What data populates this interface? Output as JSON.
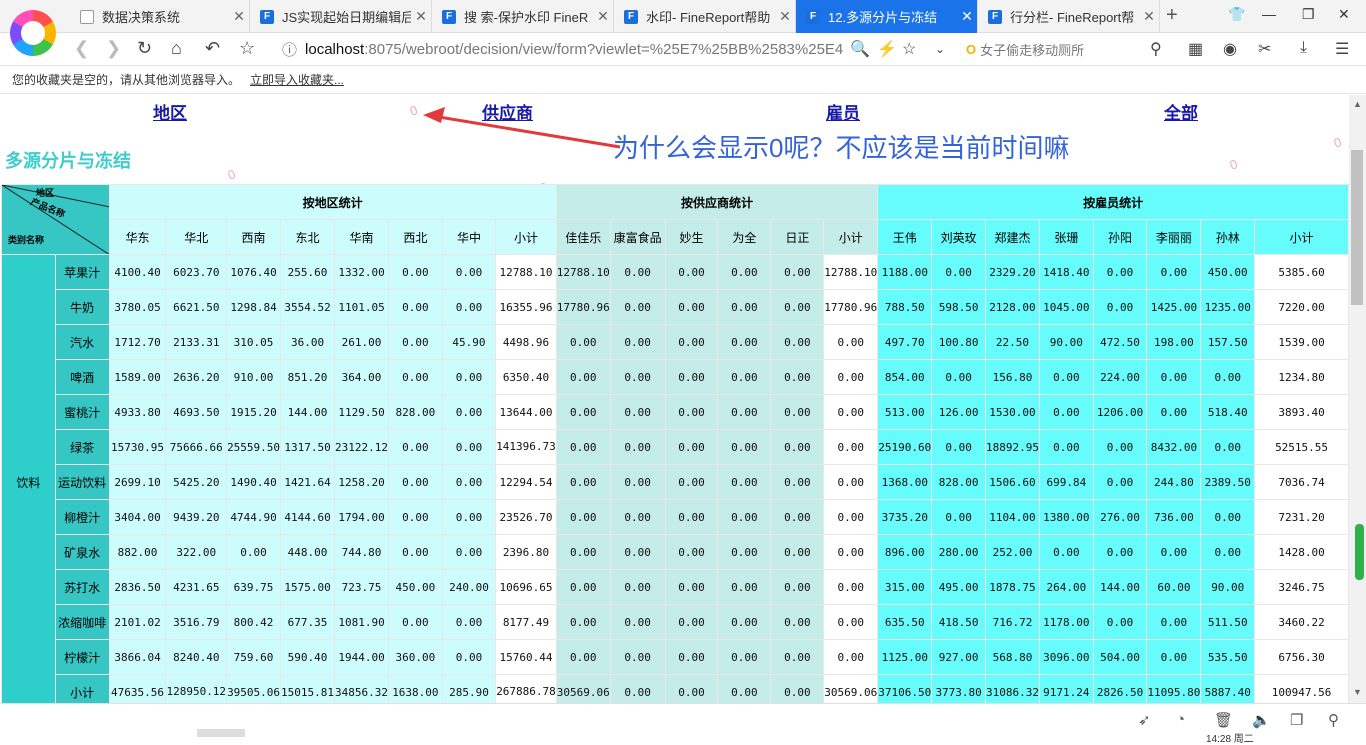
{
  "browser": {
    "tabs": [
      {
        "title": "数据决策系统",
        "icon": "doc",
        "active": false
      },
      {
        "title": "JS实现起始日期编辑后",
        "icon": "fr",
        "active": false
      },
      {
        "title": "搜 索-保护水印 FineR",
        "icon": "fr",
        "active": false
      },
      {
        "title": "水印- FineReport帮助",
        "icon": "fr",
        "active": false
      },
      {
        "title": "12.多源分片与冻结",
        "icon": "fr",
        "active": true
      },
      {
        "title": "行分栏- FineReport帮",
        "icon": "fr",
        "active": false
      }
    ],
    "url_host": "localhost",
    "url_path": ":8075/webroot/decision/view/form?viewlet=%25E7%25BB%2583%25E4",
    "search_placeholder": "女子偷走移动厕所",
    "favbar_text": "您的收藏夹是空的，请从其他浏览器导入。",
    "favbar_link": "立即导入收藏夹..."
  },
  "report": {
    "nav": [
      "地区",
      "供应商",
      "雇员",
      "全部"
    ],
    "title": "多源分片与冻结",
    "annotation": "为什么会显示0呢？不应该是当前时间嘛",
    "watermark_char": "0",
    "corner": {
      "region": "地区",
      "product": "产品名称",
      "category": "类别名称"
    },
    "groups": [
      {
        "label": "按地区统计"
      },
      {
        "label": "按供应商统计"
      },
      {
        "label": "按雇员统计"
      }
    ],
    "region_cols": [
      "华东",
      "华北",
      "西南",
      "东北",
      "华南",
      "西北",
      "华中",
      "小计"
    ],
    "supplier_cols": [
      "佳佳乐",
      "康富食品",
      "妙生",
      "为全",
      "日正",
      "小计"
    ],
    "employee_cols": [
      "王伟",
      "刘英玫",
      "郑建杰",
      "张珊",
      "孙阳",
      "李丽丽",
      "孙林",
      "小计"
    ],
    "category": "饮料",
    "rows": [
      {
        "name": "苹果汁",
        "region": [
          "4100.40",
          "6023.70",
          "1076.40",
          "255.60",
          "1332.00",
          "0.00",
          "0.00",
          "12788.10"
        ],
        "supplier": [
          "12788.10",
          "0.00",
          "0.00",
          "0.00",
          "0.00",
          "12788.10"
        ],
        "employee": [
          "1188.00",
          "0.00",
          "2329.20",
          "1418.40",
          "0.00",
          "0.00",
          "450.00",
          "5385.60"
        ]
      },
      {
        "name": "牛奶",
        "region": [
          "3780.05",
          "6621.50",
          "1298.84",
          "3554.52",
          "1101.05",
          "0.00",
          "0.00",
          "16355.96"
        ],
        "supplier": [
          "17780.96",
          "0.00",
          "0.00",
          "0.00",
          "0.00",
          "17780.96"
        ],
        "employee": [
          "788.50",
          "598.50",
          "2128.00",
          "1045.00",
          "0.00",
          "1425.00",
          "1235.00",
          "7220.00"
        ]
      },
      {
        "name": "汽水",
        "region": [
          "1712.70",
          "2133.31",
          "310.05",
          "36.00",
          "261.00",
          "0.00",
          "45.90",
          "4498.96"
        ],
        "supplier": [
          "0.00",
          "0.00",
          "0.00",
          "0.00",
          "0.00",
          "0.00"
        ],
        "employee": [
          "497.70",
          "100.80",
          "22.50",
          "90.00",
          "472.50",
          "198.00",
          "157.50",
          "1539.00"
        ]
      },
      {
        "name": "啤酒",
        "region": [
          "1589.00",
          "2636.20",
          "910.00",
          "851.20",
          "364.00",
          "0.00",
          "0.00",
          "6350.40"
        ],
        "supplier": [
          "0.00",
          "0.00",
          "0.00",
          "0.00",
          "0.00",
          "0.00"
        ],
        "employee": [
          "854.00",
          "0.00",
          "156.80",
          "0.00",
          "224.00",
          "0.00",
          "0.00",
          "1234.80"
        ]
      },
      {
        "name": "蜜桃汁",
        "region": [
          "4933.80",
          "4693.50",
          "1915.20",
          "144.00",
          "1129.50",
          "828.00",
          "0.00",
          "13644.00"
        ],
        "supplier": [
          "0.00",
          "0.00",
          "0.00",
          "0.00",
          "0.00",
          "0.00"
        ],
        "employee": [
          "513.00",
          "126.00",
          "1530.00",
          "0.00",
          "1206.00",
          "0.00",
          "518.40",
          "3893.40"
        ]
      },
      {
        "name": "绿茶",
        "region": [
          "15730.95",
          "75666.66",
          "25559.50",
          "1317.50",
          "23122.12",
          "0.00",
          "0.00",
          "141396.73"
        ],
        "supplier": [
          "0.00",
          "0.00",
          "0.00",
          "0.00",
          "0.00",
          "0.00"
        ],
        "employee": [
          "25190.60",
          "0.00",
          "18892.95",
          "0.00",
          "0.00",
          "8432.00",
          "0.00",
          "52515.55"
        ]
      },
      {
        "name": "运动饮料",
        "region": [
          "2699.10",
          "5425.20",
          "1490.40",
          "1421.64",
          "1258.20",
          "0.00",
          "0.00",
          "12294.54"
        ],
        "supplier": [
          "0.00",
          "0.00",
          "0.00",
          "0.00",
          "0.00",
          "0.00"
        ],
        "employee": [
          "1368.00",
          "828.00",
          "1506.60",
          "699.84",
          "0.00",
          "244.80",
          "2389.50",
          "7036.74"
        ]
      },
      {
        "name": "柳橙汁",
        "region": [
          "3404.00",
          "9439.20",
          "4744.90",
          "4144.60",
          "1794.00",
          "0.00",
          "0.00",
          "23526.70"
        ],
        "supplier": [
          "0.00",
          "0.00",
          "0.00",
          "0.00",
          "0.00",
          "0.00"
        ],
        "employee": [
          "3735.20",
          "0.00",
          "1104.00",
          "1380.00",
          "276.00",
          "736.00",
          "0.00",
          "7231.20"
        ]
      },
      {
        "name": "矿泉水",
        "region": [
          "882.00",
          "322.00",
          "0.00",
          "448.00",
          "744.80",
          "0.00",
          "0.00",
          "2396.80"
        ],
        "supplier": [
          "0.00",
          "0.00",
          "0.00",
          "0.00",
          "0.00",
          "0.00"
        ],
        "employee": [
          "896.00",
          "280.00",
          "252.00",
          "0.00",
          "0.00",
          "0.00",
          "0.00",
          "1428.00"
        ]
      },
      {
        "name": "苏打水",
        "region": [
          "2836.50",
          "4231.65",
          "639.75",
          "1575.00",
          "723.75",
          "450.00",
          "240.00",
          "10696.65"
        ],
        "supplier": [
          "0.00",
          "0.00",
          "0.00",
          "0.00",
          "0.00",
          "0.00"
        ],
        "employee": [
          "315.00",
          "495.00",
          "1878.75",
          "264.00",
          "144.00",
          "60.00",
          "90.00",
          "3246.75"
        ]
      },
      {
        "name": "浓缩咖啡",
        "region": [
          "2101.02",
          "3516.79",
          "800.42",
          "677.35",
          "1081.90",
          "0.00",
          "0.00",
          "8177.49"
        ],
        "supplier": [
          "0.00",
          "0.00",
          "0.00",
          "0.00",
          "0.00",
          "0.00"
        ],
        "employee": [
          "635.50",
          "418.50",
          "716.72",
          "1178.00",
          "0.00",
          "0.00",
          "511.50",
          "3460.22"
        ]
      },
      {
        "name": "柠檬汁",
        "region": [
          "3866.04",
          "8240.40",
          "759.60",
          "590.40",
          "1944.00",
          "360.00",
          "0.00",
          "15760.44"
        ],
        "supplier": [
          "0.00",
          "0.00",
          "0.00",
          "0.00",
          "0.00",
          "0.00"
        ],
        "employee": [
          "1125.00",
          "927.00",
          "568.80",
          "3096.00",
          "504.00",
          "0.00",
          "535.50",
          "6756.30"
        ]
      },
      {
        "name": "小计",
        "region": [
          "47635.56",
          "128950.12",
          "39505.06",
          "15015.81",
          "34856.32",
          "1638.00",
          "285.90",
          "267886.78"
        ],
        "supplier": [
          "30569.06",
          "0.00",
          "0.00",
          "0.00",
          "0.00",
          "30569.06"
        ],
        "employee": [
          "37106.50",
          "3773.80",
          "31086.32",
          "9171.24",
          "2826.50",
          "11095.80",
          "5887.40",
          "100947.56"
        ]
      }
    ]
  },
  "status": {
    "clock": "14:28 周二"
  }
}
